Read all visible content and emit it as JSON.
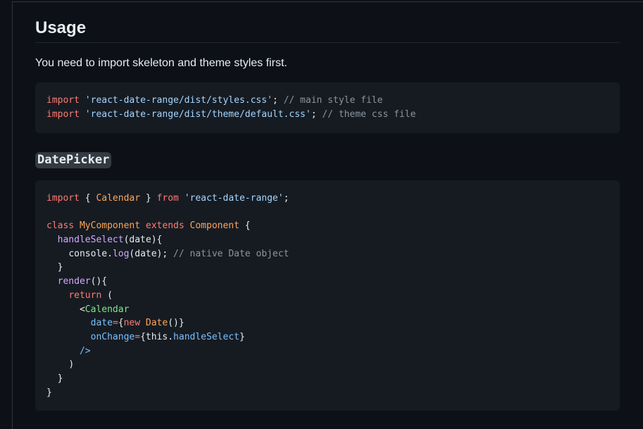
{
  "usage": {
    "heading": "Usage",
    "intro": "You need to import skeleton and theme styles first."
  },
  "code_block_1": {
    "l1": {
      "kw": "import",
      "str": "'react-date-range/dist/styles.css'",
      "punct": ";",
      "comment": "// main style file"
    },
    "l2": {
      "kw": "import",
      "str": "'react-date-range/dist/theme/default.css'",
      "punct": ";",
      "comment": "// theme css file"
    }
  },
  "datepicker": {
    "heading": "DatePicker"
  },
  "code_block_2": {
    "l1": {
      "kw_import": "import",
      "open": "{",
      "name": "Calendar",
      "close": "}",
      "kw_from": "from",
      "str": "'react-date-range'",
      "semi": ";"
    },
    "l3": {
      "kw_class": "class",
      "name": "MyComponent",
      "kw_extends": "extends",
      "base": "Component",
      "brace": "{"
    },
    "l4": {
      "fn": "handleSelect",
      "rest": "(date){"
    },
    "l5": {
      "obj": "console",
      "dot": ".",
      "fn": "log",
      "rest": "(date);",
      "comment": "// native Date object"
    },
    "l6": {
      "text": "}"
    },
    "l7": {
      "fn": "render",
      "rest": "(){"
    },
    "l8": {
      "kw": "return",
      "rest": "("
    },
    "l9": {
      "lt": "<",
      "tag": "Calendar"
    },
    "l10": {
      "attr": "date",
      "eq": "=",
      "open": "{",
      "kw": "new",
      "cls": "Date",
      "close": "()}"
    },
    "l11": {
      "attr": "onChange",
      "eq": "=",
      "open": "{",
      "this": "this",
      "dot": ".",
      "prop": "handleSelect",
      "close": "}"
    },
    "l12": {
      "text": "/>"
    },
    "l13": {
      "text": ")"
    },
    "l14": {
      "text": "}"
    },
    "l15": {
      "text": "}"
    }
  }
}
